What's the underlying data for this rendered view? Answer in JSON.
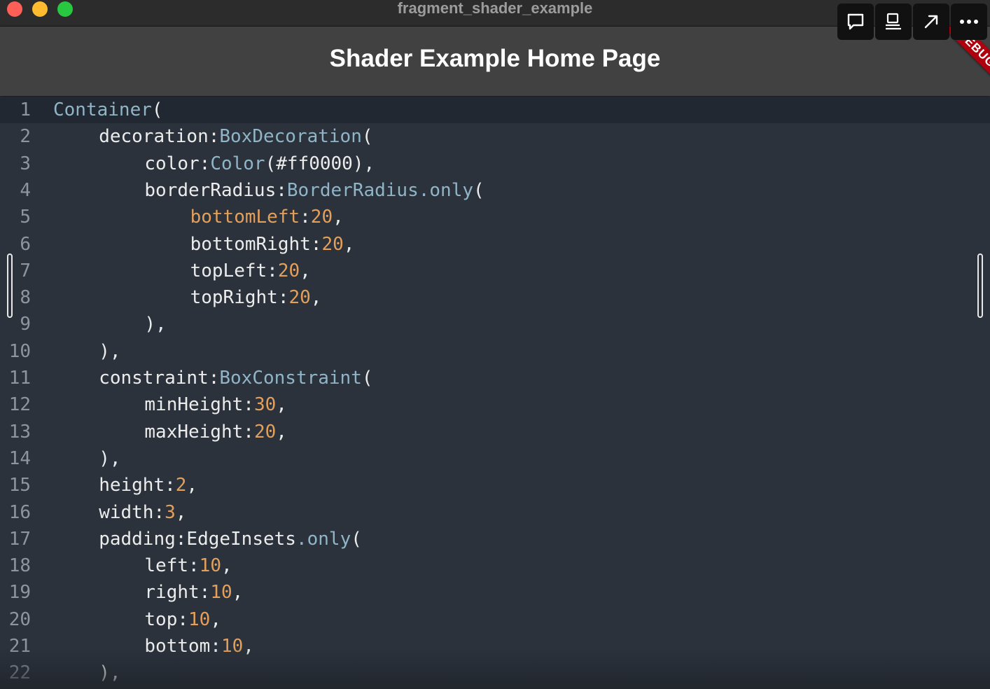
{
  "window": {
    "title": "fragment_shader_example"
  },
  "appbar": {
    "title": "Shader Example Home Page"
  },
  "toolbar": {
    "buttons": [
      {
        "name": "comment-icon"
      },
      {
        "name": "widget-inspector-icon"
      },
      {
        "name": "open-external-icon"
      },
      {
        "name": "more-icon"
      }
    ]
  },
  "debug_banner": "DEBUG",
  "colors": {
    "type": "#8fb5c7",
    "number": "#e3a05a",
    "plain": "#ececec",
    "line_number": "#8e959e",
    "background": "#2b323c",
    "appbar": "#414141",
    "debug": "#b1000d"
  },
  "code": {
    "lines": [
      {
        "n": "1",
        "indent": 0,
        "tokens": [
          [
            "type",
            "Container"
          ],
          [
            "punct",
            "("
          ]
        ]
      },
      {
        "n": "2",
        "indent": 1,
        "tokens": [
          [
            "plain",
            "decoration:"
          ],
          [
            "type",
            "BoxDecoration"
          ],
          [
            "punct",
            "("
          ]
        ]
      },
      {
        "n": "3",
        "indent": 2,
        "tokens": [
          [
            "plain",
            "color:"
          ],
          [
            "type",
            "Color"
          ],
          [
            "punct",
            "(#ff0000),"
          ]
        ]
      },
      {
        "n": "4",
        "indent": 2,
        "tokens": [
          [
            "plain",
            "borderRadius:"
          ],
          [
            "type",
            "BorderRadius.only"
          ],
          [
            "punct",
            "("
          ]
        ]
      },
      {
        "n": "5",
        "indent": 3,
        "tokens": [
          [
            "orange",
            "bottomLeft"
          ],
          [
            "plain",
            ":"
          ],
          [
            "num",
            "20"
          ],
          [
            "punct",
            ","
          ]
        ]
      },
      {
        "n": "6",
        "indent": 3,
        "tokens": [
          [
            "plain",
            "bottomRight:"
          ],
          [
            "num",
            "20"
          ],
          [
            "punct",
            ","
          ]
        ]
      },
      {
        "n": "7",
        "indent": 3,
        "tokens": [
          [
            "plain",
            "topLeft:"
          ],
          [
            "num",
            "20"
          ],
          [
            "punct",
            ","
          ]
        ]
      },
      {
        "n": "8",
        "indent": 3,
        "tokens": [
          [
            "plain",
            "topRight:"
          ],
          [
            "num",
            "20"
          ],
          [
            "punct",
            ","
          ]
        ]
      },
      {
        "n": "9",
        "indent": 2,
        "tokens": [
          [
            "punct",
            "),"
          ]
        ]
      },
      {
        "n": "10",
        "indent": 1,
        "tokens": [
          [
            "punct",
            "),"
          ]
        ]
      },
      {
        "n": "11",
        "indent": 1,
        "tokens": [
          [
            "plain",
            "constraint:"
          ],
          [
            "type",
            "BoxConstraint"
          ],
          [
            "punct",
            "("
          ]
        ]
      },
      {
        "n": "12",
        "indent": 2,
        "tokens": [
          [
            "plain",
            "minHeight:"
          ],
          [
            "num",
            "30"
          ],
          [
            "punct",
            ","
          ]
        ]
      },
      {
        "n": "13",
        "indent": 2,
        "tokens": [
          [
            "plain",
            "maxHeight:"
          ],
          [
            "num",
            "20"
          ],
          [
            "punct",
            ","
          ]
        ]
      },
      {
        "n": "14",
        "indent": 1,
        "tokens": [
          [
            "punct",
            "),"
          ]
        ]
      },
      {
        "n": "15",
        "indent": 1,
        "tokens": [
          [
            "plain",
            "height:"
          ],
          [
            "num",
            "2"
          ],
          [
            "punct",
            ","
          ]
        ]
      },
      {
        "n": "16",
        "indent": 1,
        "tokens": [
          [
            "plain",
            "width:"
          ],
          [
            "num",
            "3"
          ],
          [
            "punct",
            ","
          ]
        ]
      },
      {
        "n": "17",
        "indent": 1,
        "tokens": [
          [
            "plain",
            "padding:EdgeInsets"
          ],
          [
            "type",
            ".only"
          ],
          [
            "punct",
            "("
          ]
        ]
      },
      {
        "n": "18",
        "indent": 2,
        "tokens": [
          [
            "plain",
            "left:"
          ],
          [
            "num",
            "10"
          ],
          [
            "punct",
            ","
          ]
        ]
      },
      {
        "n": "19",
        "indent": 2,
        "tokens": [
          [
            "plain",
            "right:"
          ],
          [
            "num",
            "10"
          ],
          [
            "punct",
            ","
          ]
        ]
      },
      {
        "n": "20",
        "indent": 2,
        "tokens": [
          [
            "plain",
            "top:"
          ],
          [
            "num",
            "10"
          ],
          [
            "punct",
            ","
          ]
        ]
      },
      {
        "n": "21",
        "indent": 2,
        "tokens": [
          [
            "plain",
            "bottom:"
          ],
          [
            "num",
            "10"
          ],
          [
            "punct",
            ","
          ]
        ]
      },
      {
        "n": "22",
        "indent": 1,
        "tokens": [
          [
            "punct",
            "),"
          ]
        ]
      }
    ]
  }
}
